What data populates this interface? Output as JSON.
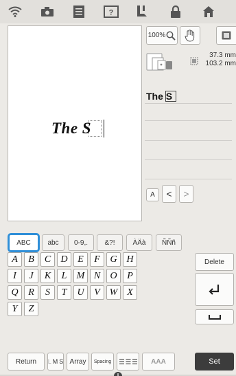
{
  "topbar": {
    "icons": [
      "wifi-icon",
      "camera-icon",
      "document-icon",
      "help-icon",
      "embroidery-foot-icon",
      "lock-icon",
      "home-icon"
    ]
  },
  "canvas": {
    "text": "The S"
  },
  "view": {
    "zoom": "100%"
  },
  "size": {
    "width": "37.3 mm",
    "height": "103.2 mm"
  },
  "text_entry": {
    "value": "The S"
  },
  "nav": {
    "font_button": "A",
    "prev": "<",
    "next": ">"
  },
  "tabs": [
    "ABC",
    "abc",
    "0-9,.",
    "&?!",
    "ÀÄà",
    "ÑÑñ"
  ],
  "selected_tab": "ABC",
  "keys": {
    "row1": [
      "A",
      "B",
      "C",
      "D",
      "E",
      "F",
      "G",
      "H"
    ],
    "row2": [
      "I",
      "J",
      "K",
      "L",
      "M",
      "N",
      "O",
      "P"
    ],
    "row3": [
      "Q",
      "R",
      "S",
      "T",
      "U",
      "V",
      "W",
      "X"
    ],
    "row4": [
      "Y",
      "Z"
    ]
  },
  "side": {
    "delete": "Delete"
  },
  "bottom": {
    "return": "Return",
    "size_l": "L",
    "size_m": "M",
    "size_s": "S",
    "array": "Array",
    "spacing": "Spacing",
    "align_icon": "align-icon",
    "font_style": "AAA",
    "set": "Set"
  },
  "colors": {
    "accent_blue": "#2f8fd8",
    "set_button": "#3c3c3c"
  }
}
